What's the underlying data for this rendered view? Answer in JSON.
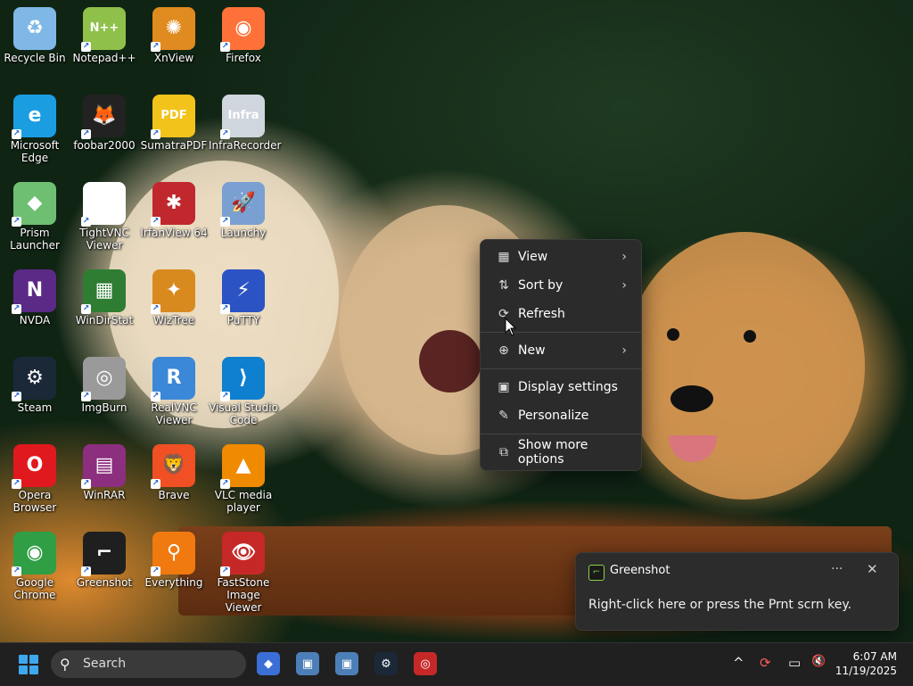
{
  "desktop_icons": [
    {
      "label": "Recycle Bin",
      "icon": "recycle-bin-icon",
      "color": "#7fb8e6",
      "glyph": "♻"
    },
    {
      "label": "Notepad++",
      "icon": "notepad-plus-plus-icon",
      "color": "#8fc14a",
      "glyph": "N++"
    },
    {
      "label": "XnView",
      "icon": "xnview-icon",
      "color": "#e08b1f",
      "glyph": "✺"
    },
    {
      "label": "Firefox",
      "icon": "firefox-icon",
      "color": "#ff7139",
      "glyph": "◉"
    },
    {
      "label": "Microsoft Edge",
      "icon": "edge-icon",
      "color": "#1b9de2",
      "glyph": "e"
    },
    {
      "label": "foobar2000",
      "icon": "foobar2000-icon",
      "color": "#222222",
      "glyph": "🦊"
    },
    {
      "label": "SumatraPDF",
      "icon": "sumatrapdf-icon",
      "color": "#f2c31b",
      "glyph": "PDF"
    },
    {
      "label": "InfraRecorder",
      "icon": "infrarecorder-icon",
      "color": "#cfd6dd",
      "glyph": "Infra"
    },
    {
      "label": "Prism Launcher",
      "icon": "prism-launcher-icon",
      "color": "#6fbf73",
      "glyph": "◆"
    },
    {
      "label": "TightVNC Viewer",
      "icon": "tightvnc-icon",
      "color": "#ffffff",
      "glyph": "VNC"
    },
    {
      "label": "IrfanView 64",
      "icon": "irfanview-icon",
      "color": "#c0282d",
      "glyph": "✱"
    },
    {
      "label": "Launchy",
      "icon": "launchy-icon",
      "color": "#7a9fd1",
      "glyph": "🚀"
    },
    {
      "label": "NVDA",
      "icon": "nvda-icon",
      "color": "#5b2a86",
      "glyph": "N"
    },
    {
      "label": "WinDirStat",
      "icon": "windirstat-icon",
      "color": "#2f7d32",
      "glyph": "▦"
    },
    {
      "label": "WizTree",
      "icon": "wiztree-icon",
      "color": "#d98a1e",
      "glyph": "✦"
    },
    {
      "label": "PuTTY",
      "icon": "putty-icon",
      "color": "#2b53c4",
      "glyph": "⚡"
    },
    {
      "label": "Steam",
      "icon": "steam-icon",
      "color": "#1b2838",
      "glyph": "⚙"
    },
    {
      "label": "ImgBurn",
      "icon": "imgburn-icon",
      "color": "#9a9a9a",
      "glyph": "◎"
    },
    {
      "label": "RealVNC Viewer",
      "icon": "realvnc-icon",
      "color": "#3b88d8",
      "glyph": "R"
    },
    {
      "label": "Visual Studio Code",
      "icon": "vscode-icon",
      "color": "#0f7fcf",
      "glyph": "⟩"
    },
    {
      "label": "Opera Browser",
      "icon": "opera-icon",
      "color": "#e0191e",
      "glyph": "O"
    },
    {
      "label": "WinRAR",
      "icon": "winrar-icon",
      "color": "#8c2f7e",
      "glyph": "▤"
    },
    {
      "label": "Brave",
      "icon": "brave-icon",
      "color": "#f05023",
      "glyph": "🦁"
    },
    {
      "label": "VLC media player",
      "icon": "vlc-icon",
      "color": "#f08a00",
      "glyph": "▲"
    },
    {
      "label": "Google Chrome",
      "icon": "chrome-icon",
      "color": "#2f9e44",
      "glyph": "◉"
    },
    {
      "label": "Greenshot",
      "icon": "greenshot-icon",
      "color": "#1f1f1f",
      "glyph": "⌐"
    },
    {
      "label": "Everything",
      "icon": "everything-icon",
      "color": "#f07a10",
      "glyph": "⚲"
    },
    {
      "label": "FastStone Image Viewer",
      "icon": "faststone-icon",
      "color": "#c62828",
      "glyph": "👁"
    }
  ],
  "context_menu": {
    "items": [
      {
        "label": "View",
        "icon": "view-grid-icon",
        "glyph": "▦",
        "submenu": true
      },
      {
        "label": "Sort by",
        "icon": "sort-icon",
        "glyph": "⇅",
        "submenu": true
      },
      {
        "label": "Refresh",
        "icon": "refresh-icon",
        "glyph": "⟳",
        "submenu": false
      },
      {
        "label": "New",
        "icon": "new-plus-icon",
        "glyph": "⊕",
        "submenu": true
      },
      {
        "label": "Display settings",
        "icon": "display-settings-icon",
        "glyph": "▣",
        "submenu": false
      },
      {
        "label": "Personalize",
        "icon": "personalize-brush-icon",
        "glyph": "✎",
        "submenu": false
      },
      {
        "label": "Show more options",
        "icon": "show-more-options-icon",
        "glyph": "⧉",
        "submenu": false
      }
    ],
    "chevron": "›"
  },
  "notification": {
    "app": "Greenshot",
    "message": "Right-click here or press the Prnt scrn key.",
    "more": "···",
    "close": "✕"
  },
  "taskbar": {
    "search_label": "Search",
    "pinned": [
      {
        "name": "prism-launcher-taskbar-icon",
        "color": "#3b6fd6",
        "glyph": "◆"
      },
      {
        "name": "tightvnc-taskbar-icon",
        "color": "#4c7fb8",
        "glyph": "▣"
      },
      {
        "name": "realvnc-taskbar-icon",
        "color": "#4c7fb8",
        "glyph": "▣"
      },
      {
        "name": "steam-taskbar-icon",
        "color": "#1b2838",
        "glyph": "⚙"
      },
      {
        "name": "lifebuoy-taskbar-icon",
        "color": "#c62828",
        "glyph": "◎"
      }
    ],
    "tray": {
      "chevron": "^",
      "sync": "⟳",
      "network": "▭",
      "volume": "🔇"
    },
    "time": "6:07 AM",
    "date": "11/19/2025"
  }
}
